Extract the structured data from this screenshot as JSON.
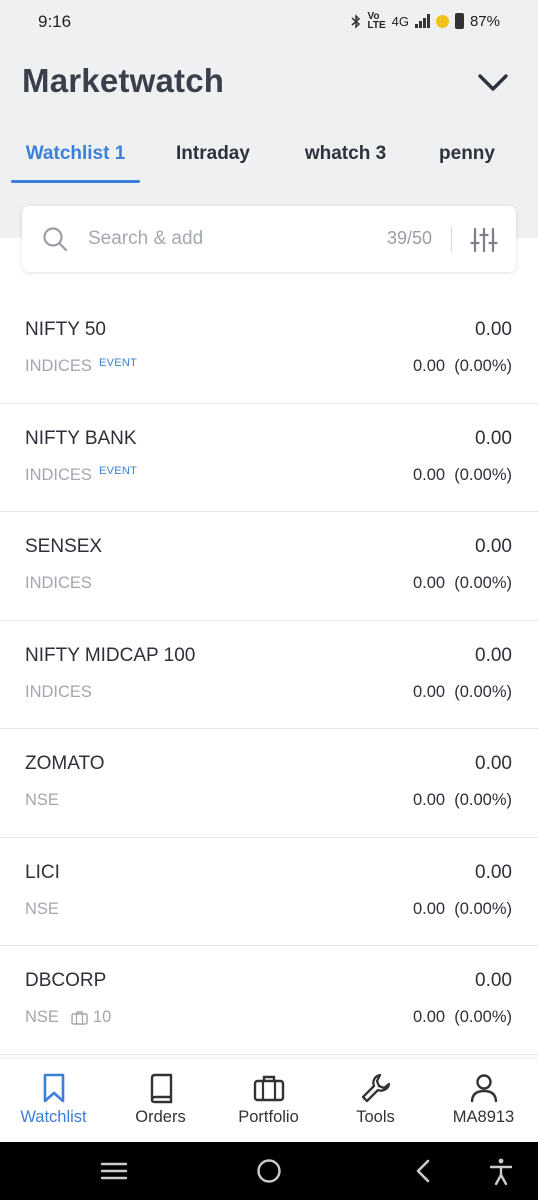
{
  "status_bar": {
    "time": "9:16",
    "network": "4G",
    "battery": "87%"
  },
  "header": {
    "title": "Marketwatch"
  },
  "tabs": [
    {
      "label": "Watchlist 1"
    },
    {
      "label": "Intraday"
    },
    {
      "label": "whatch 3"
    },
    {
      "label": "penny"
    }
  ],
  "search": {
    "placeholder": "Search & add",
    "count": "39/50"
  },
  "items": [
    {
      "symbol": "NIFTY 50",
      "exchange": "INDICES",
      "tag": "EVENT",
      "ltp": "0.00",
      "change": "0.00  (0.00%)"
    },
    {
      "symbol": "NIFTY BANK",
      "exchange": "INDICES",
      "tag": "EVENT",
      "ltp": "0.00",
      "change": "0.00  (0.00%)"
    },
    {
      "symbol": "SENSEX",
      "exchange": "INDICES",
      "ltp": "0.00",
      "change": "0.00  (0.00%)"
    },
    {
      "symbol": "NIFTY MIDCAP 100",
      "exchange": "INDICES",
      "ltp": "0.00",
      "change": "0.00  (0.00%)"
    },
    {
      "symbol": "ZOMATO",
      "exchange": "NSE",
      "ltp": "0.00",
      "change": "0.00  (0.00%)"
    },
    {
      "symbol": "LICI",
      "exchange": "NSE",
      "ltp": "0.00",
      "change": "0.00  (0.00%)"
    },
    {
      "symbol": "DBCORP",
      "exchange": "NSE",
      "holding_qty": "10",
      "ltp": "0.00",
      "change": "0.00  (0.00%)"
    }
  ],
  "bottom_nav": [
    {
      "label": "Watchlist",
      "icon": "bookmark-icon"
    },
    {
      "label": "Orders",
      "icon": "book-icon"
    },
    {
      "label": "Portfolio",
      "icon": "briefcase-icon"
    },
    {
      "label": "Tools",
      "icon": "wrench-icon"
    },
    {
      "label": "MA8913",
      "icon": "user-icon"
    }
  ],
  "colors": {
    "accent": "#3d7fd9",
    "header_bg": "#eef0f2",
    "muted": "#a2a6ae"
  }
}
